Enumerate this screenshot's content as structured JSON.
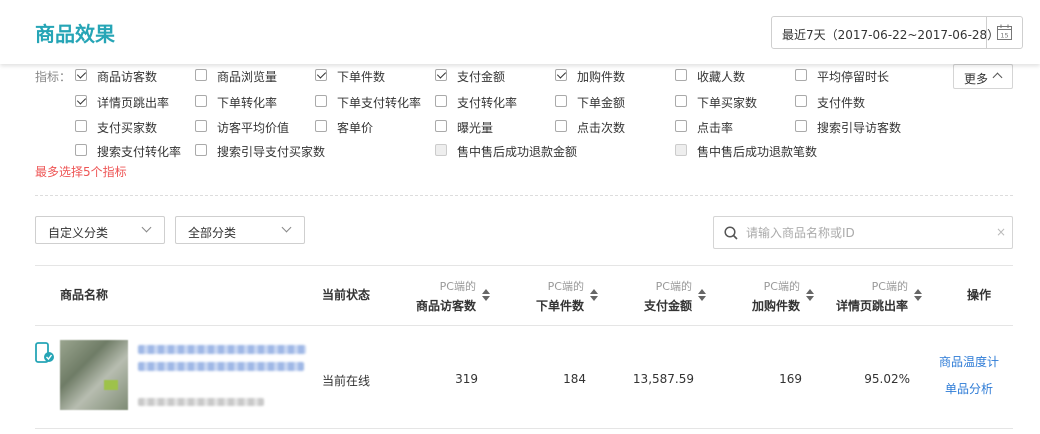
{
  "header": {
    "title": "商品效果",
    "date_range": "最近7天（2017-06-22~2017-06-28）",
    "calendar_day": "15"
  },
  "indicators": {
    "label": "指标：",
    "items": [
      {
        "label": "商品访客数",
        "checked": true
      },
      {
        "label": "商品浏览量",
        "checked": false
      },
      {
        "label": "下单件数",
        "checked": true
      },
      {
        "label": "支付金额",
        "checked": true
      },
      {
        "label": "加购件数",
        "checked": true
      },
      {
        "label": "收藏人数",
        "checked": false
      },
      {
        "label": "平均停留时长",
        "checked": false
      },
      {
        "label": "详情页跳出率",
        "checked": true
      },
      {
        "label": "下单转化率",
        "checked": false
      },
      {
        "label": "下单支付转化率",
        "checked": false
      },
      {
        "label": "支付转化率",
        "checked": false
      },
      {
        "label": "下单金额",
        "checked": false
      },
      {
        "label": "下单买家数",
        "checked": false
      },
      {
        "label": "支付件数",
        "checked": false
      },
      {
        "label": "支付买家数",
        "checked": false
      },
      {
        "label": "访客平均价值",
        "checked": false
      },
      {
        "label": "客单价",
        "checked": false
      },
      {
        "label": "曝光量",
        "checked": false
      },
      {
        "label": "点击次数",
        "checked": false
      },
      {
        "label": "点击率",
        "checked": false
      },
      {
        "label": "搜索引导访客数",
        "checked": false
      },
      {
        "label": "搜索支付转化率",
        "checked": false
      },
      {
        "label": "搜索引导支付买家数",
        "checked": false
      },
      {
        "label": "售中售后成功退款金额",
        "checked": false,
        "disabled": true
      },
      {
        "label": "售中售后成功退款笔数",
        "checked": false,
        "disabled": true
      }
    ],
    "more_label": "更多",
    "hint": "最多选择5个指标"
  },
  "filters": {
    "custom_category": "自定义分类",
    "all_category": "全部分类",
    "search_placeholder": "请输入商品名称或ID",
    "clear": "×"
  },
  "table": {
    "col_name": "商品名称",
    "col_status": "当前状态",
    "col_ops": "操作",
    "metric_prefix": "PC端的",
    "metrics": [
      "商品访客数",
      "下单件数",
      "支付金额",
      "加购件数",
      "详情页跳出率"
    ],
    "rows": [
      {
        "status": "当前在线",
        "values": [
          "319",
          "184",
          "13,587.59",
          "169",
          "95.02%"
        ],
        "ops": [
          "商品温度计",
          "单品分析"
        ]
      }
    ]
  }
}
